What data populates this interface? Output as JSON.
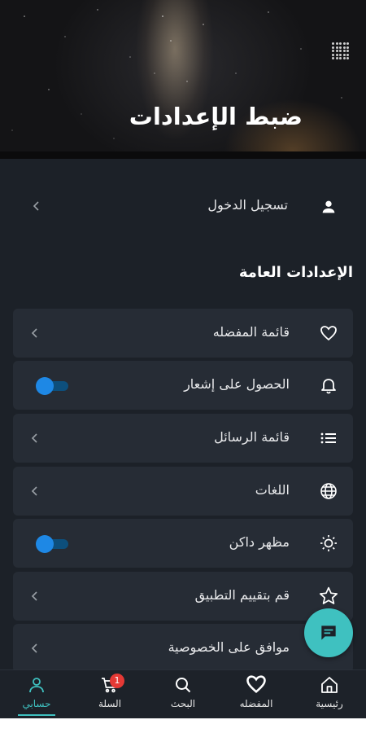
{
  "header": {
    "title": "ضبط الإعدادات",
    "grid_icon": "dots-grid-icon"
  },
  "login": {
    "label": "تسجيل الدخول",
    "icon": "user-icon"
  },
  "general_settings": {
    "title": "الإعدادات العامة",
    "items": [
      {
        "label": "قائمة المفضله",
        "icon": "heart-icon",
        "control": "chevron"
      },
      {
        "label": "الحصول على إشعار",
        "icon": "bell-icon",
        "control": "toggle",
        "toggle_on": false
      },
      {
        "label": "قائمة الرسائل",
        "icon": "list-icon",
        "control": "chevron"
      },
      {
        "label": "اللغات",
        "icon": "globe-icon",
        "control": "chevron"
      },
      {
        "label": "مظهر داكن",
        "icon": "sun-icon",
        "control": "toggle",
        "toggle_on": false
      },
      {
        "label": "قم بتقييم التطبيق",
        "icon": "star-icon",
        "control": "chevron"
      },
      {
        "label": "موافق على الخصوصية",
        "icon": "shield-icon",
        "control": "chevron"
      }
    ]
  },
  "fab": {
    "icon": "chat-icon"
  },
  "bottom_nav": {
    "items": [
      {
        "label": "رئيسية",
        "icon": "home-icon"
      },
      {
        "label": "المفضله",
        "icon": "heart-icon"
      },
      {
        "label": "البحث",
        "icon": "search-icon"
      },
      {
        "label": "السلة",
        "icon": "cart-icon",
        "badge": "1"
      },
      {
        "label": "حسابي",
        "icon": "user-icon",
        "active": true
      }
    ]
  },
  "colors": {
    "background": "#1c2128",
    "card": "#262c35",
    "accent": "#3fc1c0",
    "toggle": "#1e88e5",
    "badge": "#e53935"
  }
}
